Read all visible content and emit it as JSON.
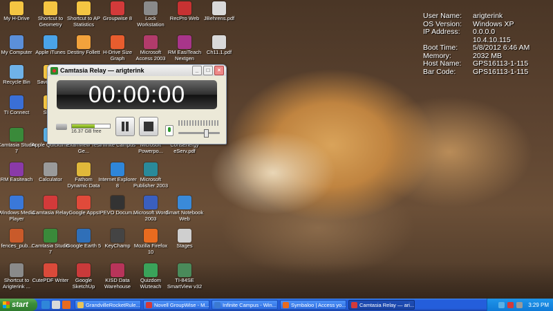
{
  "desktop": {
    "icons": [
      {
        "label": "My H-Drive",
        "color": "#f5c542"
      },
      {
        "label": "Shortcut to Geometry",
        "color": "#f5c542"
      },
      {
        "label": "Shortcut to AP Statistics",
        "color": "#f5c542"
      },
      {
        "label": "Groupwise 8",
        "color": "#d33a3a"
      },
      {
        "label": "Lock Workstation",
        "color": "#8a8a8a"
      },
      {
        "label": "RecPro Web",
        "color": "#c73232"
      },
      {
        "label": "JBehrens.pdf",
        "color": "#d9d9d9"
      },
      {
        "label": "My Computer",
        "color": "#5b8fd9"
      },
      {
        "label": "Apple iTunes",
        "color": "#4aa3e8"
      },
      {
        "label": "Destiny Follett",
        "color": "#f2a23c"
      },
      {
        "label": "H-Drive Size Graph",
        "color": "#e85d2e"
      },
      {
        "label": "Microsoft Access 2003",
        "color": "#b23b6b"
      },
      {
        "label": "RM EasiTeach Nextgen",
        "color": "#a8358a"
      },
      {
        "label": "Ch11.1.pdf",
        "color": "#d9d9d9"
      },
      {
        "label": "Recycle Bin",
        "color": "#6fb2e8"
      },
      {
        "label": "Savi I-Drive",
        "color": "#f5c542"
      },
      {
        "label": "TI Connect",
        "color": "#3a6fd6"
      },
      {
        "label": "Sweet",
        "color": "#f5c542"
      },
      {
        "label": "Camtasia Studio 7",
        "color": "#3a8a3a"
      },
      {
        "label": "Apple Quicktime",
        "color": "#5ab0e6"
      },
      {
        "label": "Examview Test Ge...",
        "color": "#2f7fc9"
      },
      {
        "label": "Infinite Campus",
        "color": "#3c7ad1"
      },
      {
        "label": "Microsoft Powerpo...",
        "color": "#d9573a"
      },
      {
        "label": "ConsEnergy eServ.pdf",
        "color": "#d9d9d9"
      },
      {
        "label": "RM Easiteach",
        "color": "#8a3aa8"
      },
      {
        "label": "Calculator",
        "color": "#9a9a9a"
      },
      {
        "label": "Fathom Dynamic Data",
        "color": "#e0b83a"
      },
      {
        "label": "Internet Explorer 8",
        "color": "#2f86d9"
      },
      {
        "label": "Microsoft Publisher 2003",
        "color": "#2a8a9a"
      },
      {
        "label": "Windows Media Player",
        "color": "#3a78d9"
      },
      {
        "label": "Camtasia Relay",
        "color": "#d33a3a"
      },
      {
        "label": "Google Apps",
        "color": "#e04a3a"
      },
      {
        "label": "IPEVO Docum...",
        "color": "#333333"
      },
      {
        "label": "Microsoft Word 2003",
        "color": "#3a5fbf"
      },
      {
        "label": "Smart Notebook Web",
        "color": "#3a8ad9"
      },
      {
        "label": "fences_pub...",
        "color": "#c95a2a"
      },
      {
        "label": "Camtasia Studio 7",
        "color": "#3a8a3a"
      },
      {
        "label": "Google Earth 5",
        "color": "#2f6fb8"
      },
      {
        "label": "KeyChamp",
        "color": "#444444"
      },
      {
        "label": "Mozilla Firefox 10",
        "color": "#e86b1f"
      },
      {
        "label": "Stages",
        "color": "#cfcfcf"
      },
      {
        "label": "Shortcut to Arigterink ...",
        "color": "#8a8a8a"
      },
      {
        "label": "CutePDF Writer",
        "color": "#d94a3a"
      },
      {
        "label": "Google SketchUp",
        "color": "#c93a3a"
      },
      {
        "label": "KISD Data Warehouse",
        "color": "#b8345a"
      },
      {
        "label": "Quizdom Wizteach",
        "color": "#3aa35a"
      },
      {
        "label": "TI-84SE SmartView v32",
        "color": "#4a8a5a"
      }
    ]
  },
  "sysinfo": [
    {
      "key": "User Name:",
      "value": "arigterink"
    },
    {
      "key": "OS Version:",
      "value": "Windows XP"
    },
    {
      "key": "IP Address:",
      "value": "0.0.0.0"
    },
    {
      "key": "",
      "value": "10.4.10.115"
    },
    {
      "key": "Boot Time:",
      "value": "5/8/2012 6:46 AM"
    },
    {
      "key": "Memory:",
      "value": "2032 MB"
    },
    {
      "key": "Host Name:",
      "value": "GPS16113-1-115"
    },
    {
      "key": "Bar Code:",
      "value": "GPS16113-1-115"
    }
  ],
  "camtasia": {
    "title": "Camtasia Relay — arigterink",
    "timer": "00:00:00",
    "disk_free": "16.37 GB free",
    "disk_used_fraction": 0.6,
    "mic_level_fraction": 0.0,
    "volume_fraction": 0.67
  },
  "taskbar": {
    "start_label": "start",
    "tasks": [
      {
        "label": "GrandvilleRocketRule...",
        "color": "#e8c45a",
        "active": false
      },
      {
        "label": "Novell GroupWise - M...",
        "color": "#d33a3a",
        "active": false
      },
      {
        "label": "Infinite Campus - Win...",
        "color": "#3c7ad1",
        "active": false
      },
      {
        "label": "Symbaloo | Access yo...",
        "color": "#e86b1f",
        "active": false
      },
      {
        "label": "Camtasia Relay — ari...",
        "color": "#d33a3a",
        "active": true
      }
    ],
    "clock": "3:29 PM"
  }
}
